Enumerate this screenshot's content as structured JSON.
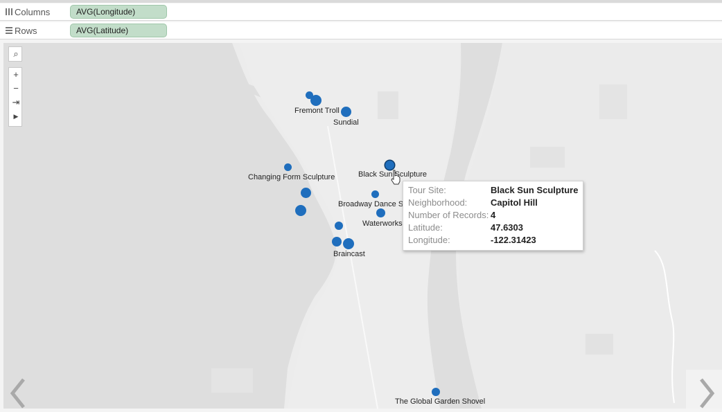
{
  "shelves": {
    "columns": {
      "label": "Columns",
      "field": "AVG(Longitude)"
    },
    "rows": {
      "label": "Rows",
      "field": "AVG(Latitude)"
    }
  },
  "map_controls": [
    "search-icon",
    "zoom-in-icon",
    "zoom-out-icon",
    "pin-icon",
    "expand-icon"
  ],
  "mark_color": "#1f6ebd",
  "marks": [
    {
      "label": "Fremont Troll"
    },
    {
      "label": "Sundial"
    },
    {
      "label": "Changing Form Sculpture"
    },
    {
      "label": "Black Sun Sculpture"
    },
    {
      "label": "Broadway Dance Ste"
    },
    {
      "label": "Waterworks"
    },
    {
      "label": "Braincast"
    },
    {
      "label": "The Global Garden Shovel"
    }
  ],
  "tooltip": {
    "rows": [
      {
        "key": "Tour Site:",
        "value": "Black Sun Sculpture"
      },
      {
        "key": "Neighborhood:",
        "value": "Capitol Hill"
      },
      {
        "key": "Number of Records:",
        "value": "4"
      },
      {
        "key": "Latitude:",
        "value": "47.6303"
      },
      {
        "key": "Longitude:",
        "value": "-122.31423"
      }
    ]
  }
}
